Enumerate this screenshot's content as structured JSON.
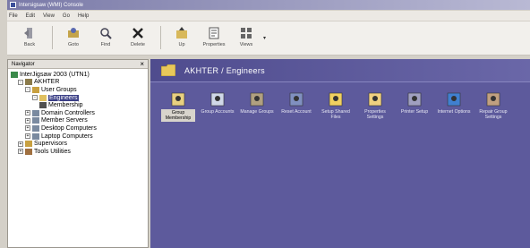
{
  "window": {
    "title": "Intersigsaw (WMI) Console"
  },
  "menu": [
    "File",
    "Edit",
    "View",
    "Go",
    "Help"
  ],
  "toolbar": [
    {
      "label": "Back",
      "icon": "back-icon"
    },
    {
      "label": "Goto",
      "icon": "goto-icon"
    },
    {
      "label": "Find",
      "icon": "find-icon"
    },
    {
      "label": "Delete",
      "icon": "delete-icon"
    },
    {
      "label": "Up",
      "icon": "up-folder-icon"
    },
    {
      "label": "Properties",
      "icon": "properties-icon"
    },
    {
      "label": "Views",
      "icon": "views-icon"
    }
  ],
  "navigator": {
    "title": "Navigator",
    "close": "×",
    "tree": [
      {
        "label": "InterJigsaw 2003 (UTN1)",
        "level": 0,
        "expander": "",
        "icon": "globe"
      },
      {
        "label": "AKHTER",
        "level": 1,
        "expander": "-",
        "icon": "domain"
      },
      {
        "label": "User Groups",
        "level": 2,
        "expander": "-",
        "icon": "group"
      },
      {
        "label": "Engineers",
        "level": 3,
        "expander": "-",
        "icon": "folder",
        "selected": true
      },
      {
        "label": "Membership",
        "level": 4,
        "expander": "",
        "icon": "member"
      },
      {
        "label": "Domain Controllers",
        "level": 2,
        "expander": "+",
        "icon": "computer"
      },
      {
        "label": "Member Servers",
        "level": 2,
        "expander": "+",
        "icon": "computer"
      },
      {
        "label": "Desktop Computers",
        "level": 2,
        "expander": "+",
        "icon": "computer"
      },
      {
        "label": "Laptop Computers",
        "level": 2,
        "expander": "+",
        "icon": "computer"
      },
      {
        "label": "Supervisors",
        "level": 1,
        "expander": "+",
        "icon": "group"
      },
      {
        "label": "Tools Utilities",
        "level": 1,
        "expander": "+",
        "icon": "tools"
      }
    ]
  },
  "content": {
    "header": "AKHTER / Engineers",
    "items": [
      {
        "label": "Group Membership",
        "icon": "membership-icon",
        "selected": true
      },
      {
        "label": "Group Accounts",
        "icon": "accounts-icon"
      },
      {
        "label": "Manage Groups",
        "icon": "manage-groups-icon"
      },
      {
        "label": "Reset Account",
        "icon": "reset-account-icon"
      },
      {
        "label": "Setup Shared Files",
        "icon": "shared-files-icon"
      },
      {
        "label": "Properties Settings",
        "icon": "properties-settings-icon"
      },
      {
        "label": "Printer Setup",
        "icon": "printer-icon"
      },
      {
        "label": "Internet Options",
        "icon": "internet-icon"
      },
      {
        "label": "Repair Group Settings",
        "icon": "repair-icon"
      }
    ]
  },
  "colors": {
    "content_bg": "#5d5a9c",
    "selection": "#3b3f86"
  }
}
